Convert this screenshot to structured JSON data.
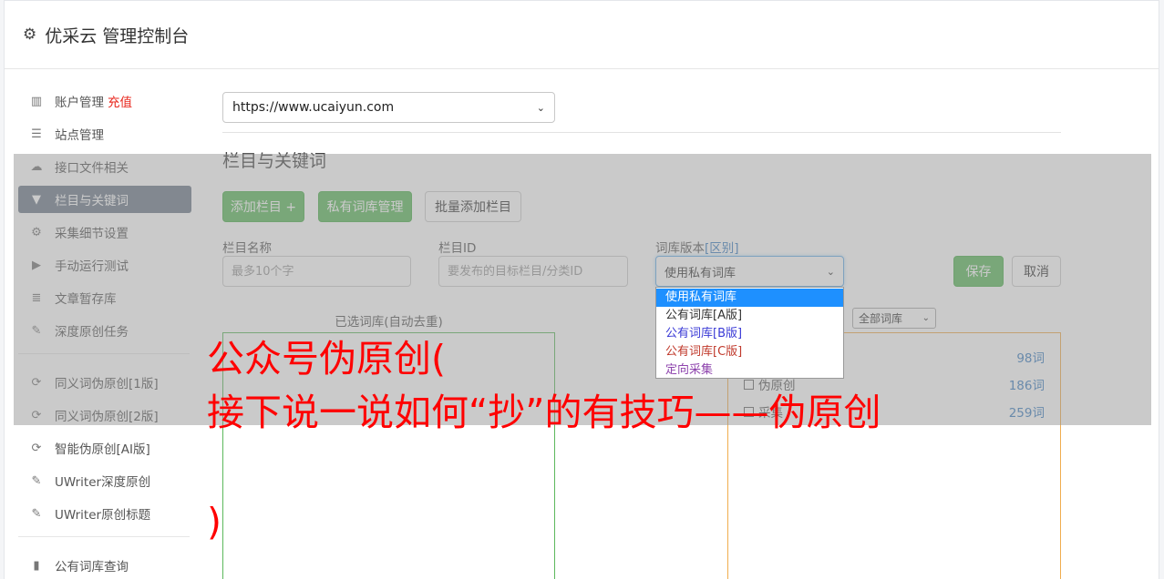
{
  "header": {
    "title": "优采云 管理控制台",
    "icon": "gear-icon"
  },
  "sidebar": {
    "recharge": "充值",
    "items": [
      {
        "label": "账户管理",
        "icon": "bar-chart-icon"
      },
      {
        "label": "站点管理",
        "icon": "server-icon"
      },
      {
        "label": "接口文件相关",
        "icon": "cloud-upload-icon"
      },
      {
        "label": "栏目与关键词",
        "icon": "filter-icon"
      },
      {
        "label": "采集细节设置",
        "icon": "gears-icon"
      },
      {
        "label": "手动运行测试",
        "icon": "play-circle-icon"
      },
      {
        "label": "文章暂存库",
        "icon": "database-icon"
      },
      {
        "label": "深度原创任务",
        "icon": "edit-icon"
      },
      {
        "label": "同义词伪原创[1版]",
        "icon": "refresh-icon"
      },
      {
        "label": "同义词伪原创[2版]",
        "icon": "refresh-icon"
      },
      {
        "label": "智能伪原创[AI版]",
        "icon": "refresh-icon"
      },
      {
        "label": "UWriter深度原创",
        "icon": "edit-icon"
      },
      {
        "label": "UWriter原创标题",
        "icon": "edit-icon"
      },
      {
        "label": "公有词库查询",
        "icon": "book-icon"
      }
    ]
  },
  "main": {
    "site_select": "https://www.ucaiyun.com",
    "section_title": "栏目与关键词",
    "buttons": {
      "add_column": "添加栏目 +",
      "private_lib": "私有词库管理",
      "batch_add": "批量添加栏目"
    },
    "form": {
      "name_label": "栏目名称",
      "name_placeholder": "最多10个字",
      "id_label": "栏目ID",
      "id_placeholder": "要发布的目标栏目/分类ID",
      "version_label": "词库版本",
      "version_diff": "[区别]",
      "version_selected": "使用私有词库",
      "save": "保存",
      "cancel": "取消"
    },
    "dropdown_options": [
      {
        "label": "使用私有词库",
        "color": "#ffffff"
      },
      {
        "label": "公有词库[A版]",
        "color": "#333333"
      },
      {
        "label": "公有词库[B版]",
        "color": "#3a3ad6"
      },
      {
        "label": "公有词库[C版]",
        "color": "#c0392b"
      },
      {
        "label": "定向采集",
        "color": "#8e44ad"
      }
    ],
    "selected_lib_caption": "已选词库(自动去重)",
    "lib_filter": "全部词库",
    "lib_rows": [
      {
        "name": "",
        "count": "98词"
      },
      {
        "name": "伪原创",
        "count": "186词"
      },
      {
        "name": "采集",
        "count": "259词"
      }
    ]
  },
  "overlay_text": {
    "line1": "公众号伪原创(",
    "line2": "接下说一说如何“抄”的有技巧——伪原创",
    "line3": ")"
  },
  "colors": {
    "accent_green": "#5cb85c",
    "active_nav": "#6e7a8a",
    "banner_red": "#ff0000"
  }
}
